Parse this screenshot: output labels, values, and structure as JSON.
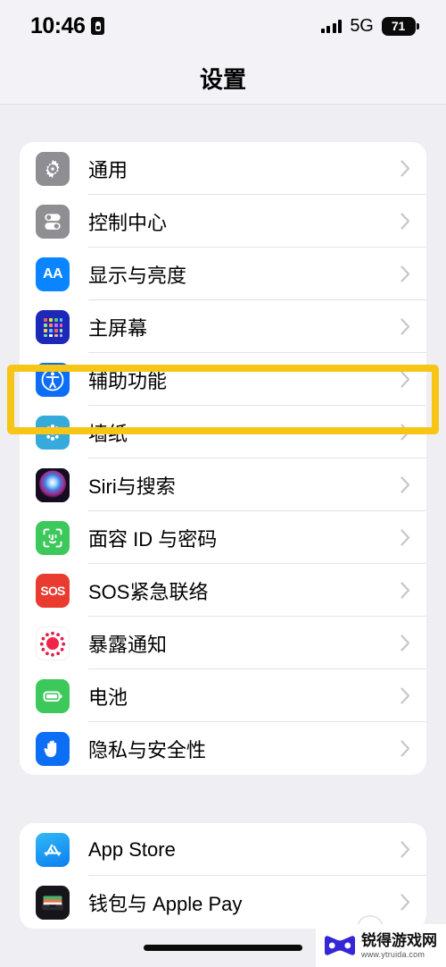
{
  "status_bar": {
    "time": "10:46",
    "privacy_icon": "privacy-badge-icon",
    "signal_icon": "cellular-bars-icon",
    "network": "5G",
    "battery_level": "71"
  },
  "nav": {
    "title": "设置"
  },
  "highlight": {
    "color": "#f6c516",
    "target": "辅助功能"
  },
  "sections": [
    {
      "id": "clipped-section",
      "clipped": true,
      "items": [
        {
          "label": "",
          "icon": "clipped-purple-app-icon"
        }
      ]
    },
    {
      "id": "system-section",
      "items": [
        {
          "label": "通用",
          "icon": "gear-icon",
          "chevron": "chevron-right-icon"
        },
        {
          "label": "控制中心",
          "icon": "control-center-icon",
          "chevron": "chevron-right-icon"
        },
        {
          "label": "显示与亮度",
          "icon": "display-brightness-icon",
          "chevron": "chevron-right-icon"
        },
        {
          "label": "主屏幕",
          "icon": "home-screen-icon",
          "chevron": "chevron-right-icon"
        },
        {
          "label": "辅助功能",
          "icon": "accessibility-icon",
          "chevron": "chevron-right-icon"
        },
        {
          "label": "墙纸",
          "icon": "wallpaper-icon",
          "chevron": "chevron-right-icon"
        },
        {
          "label": "Siri与搜索",
          "icon": "siri-search-icon",
          "chevron": "chevron-right-icon"
        },
        {
          "label": "面容 ID 与密码",
          "icon": "face-id-icon",
          "chevron": "chevron-right-icon"
        },
        {
          "label": "SOS紧急联络",
          "icon": "emergency-sos-icon",
          "chevron": "chevron-right-icon"
        },
        {
          "label": "暴露通知",
          "icon": "exposure-notifications-icon",
          "chevron": "chevron-right-icon"
        },
        {
          "label": "电池",
          "icon": "battery-icon",
          "chevron": "chevron-right-icon"
        },
        {
          "label": "隐私与安全性",
          "icon": "privacy-security-icon",
          "chevron": "chevron-right-icon"
        }
      ]
    },
    {
      "id": "store-section",
      "items": [
        {
          "label": "App Store",
          "icon": "app-store-icon",
          "chevron": "chevron-right-icon"
        },
        {
          "label": "钱包与 Apple Pay",
          "icon": "wallet-apple-pay-icon",
          "chevron": "chevron-right-icon"
        }
      ]
    }
  ],
  "watermark": {
    "site_name": "锐得游戏网",
    "url": "www.ytruida.com",
    "logo": "bowtie-logo-icon",
    "color": "#3526d6"
  },
  "home_indicator": "home-indicator"
}
